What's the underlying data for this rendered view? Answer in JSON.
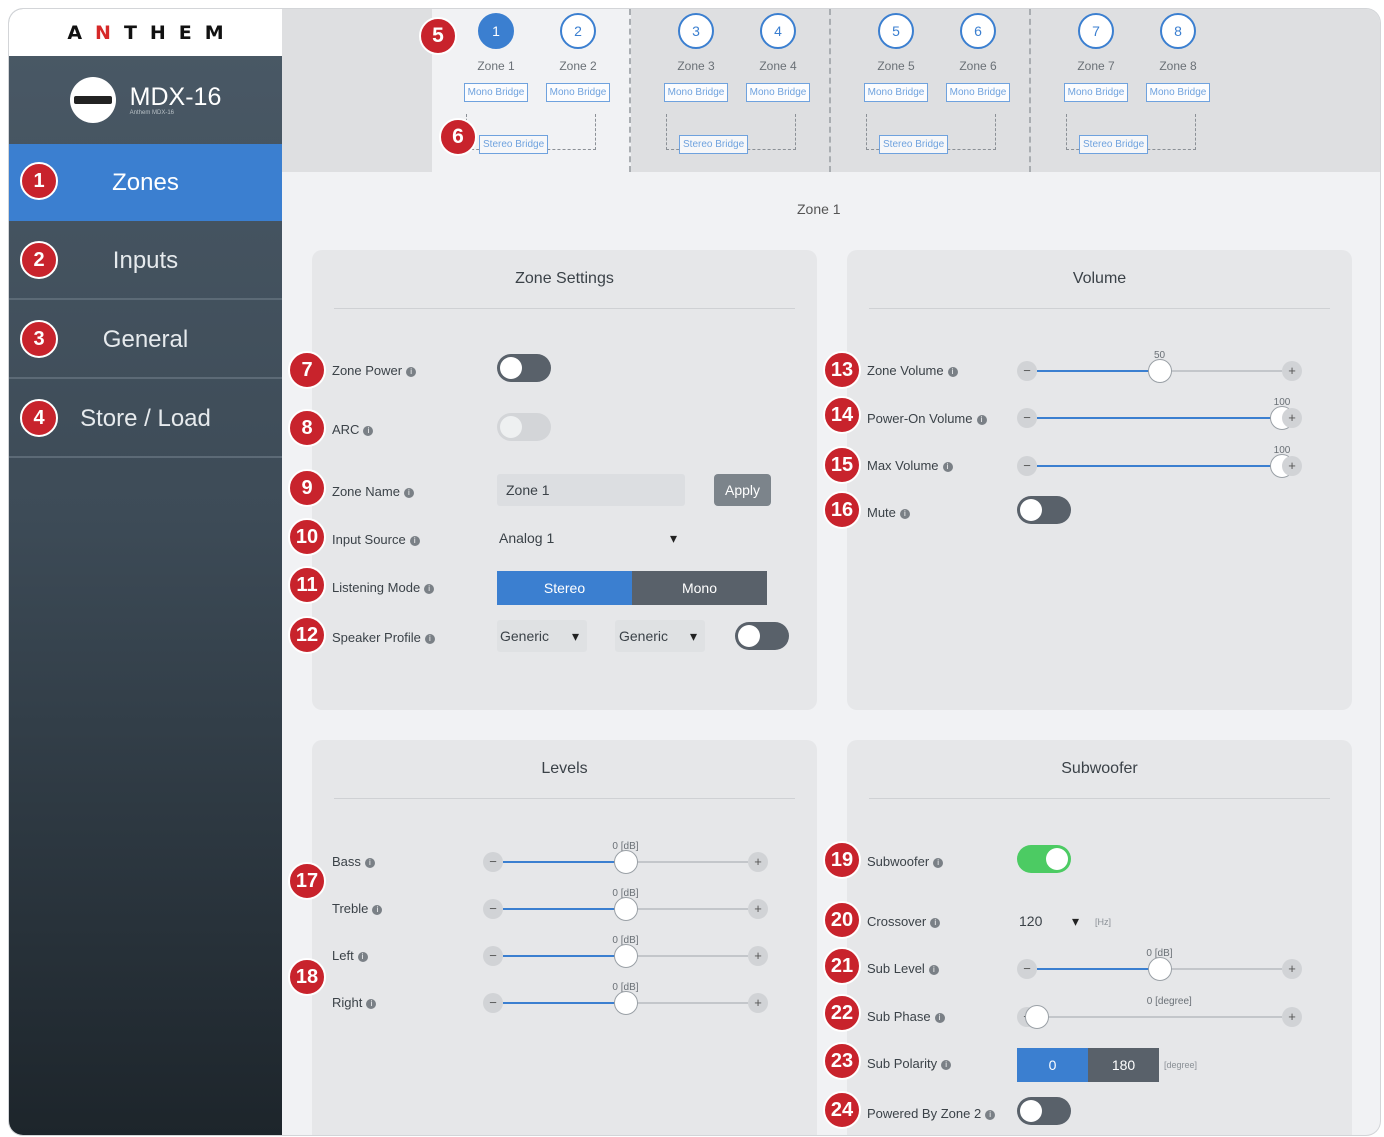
{
  "brand": {
    "logo_a": "A",
    "logo_n": "N",
    "logo_rest": "THEM",
    "device": "MDX-16",
    "device_sub": "Anthem MDX-16"
  },
  "nav": [
    {
      "label": "Zones",
      "badge": "1"
    },
    {
      "label": "Inputs",
      "badge": "2"
    },
    {
      "label": "General",
      "badge": "3"
    },
    {
      "label": "Store / Load",
      "badge": "4"
    }
  ],
  "zones": [
    {
      "num": "1",
      "label": "Zone 1",
      "bridge": "Mono Bridge"
    },
    {
      "num": "2",
      "label": "Zone 2",
      "bridge": "Mono Bridge"
    },
    {
      "num": "3",
      "label": "Zone 3",
      "bridge": "Mono Bridge"
    },
    {
      "num": "4",
      "label": "Zone 4",
      "bridge": "Mono Bridge"
    },
    {
      "num": "5",
      "label": "Zone 5",
      "bridge": "Mono Bridge"
    },
    {
      "num": "6",
      "label": "Zone 6",
      "bridge": "Mono Bridge"
    },
    {
      "num": "7",
      "label": "Zone 7",
      "bridge": "Mono Bridge"
    },
    {
      "num": "8",
      "label": "Zone 8",
      "bridge": "Mono Bridge"
    }
  ],
  "stereo_bridge": "Stereo Bridge",
  "zone_title": "Zone 1",
  "zone_settings": {
    "title": "Zone Settings",
    "zone_power": {
      "label": "Zone Power",
      "on": false
    },
    "arc": {
      "label": "ARC",
      "enabled": false
    },
    "zone_name": {
      "label": "Zone Name",
      "value": "Zone 1",
      "apply": "Apply"
    },
    "input_source": {
      "label": "Input Source",
      "value": "Analog 1"
    },
    "listening_mode": {
      "label": "Listening Mode",
      "options": [
        "Stereo",
        "Mono"
      ],
      "selected": "Stereo"
    },
    "speaker_profile": {
      "label": "Speaker Profile",
      "left": "Generic",
      "right": "Generic",
      "on": false
    }
  },
  "volume": {
    "title": "Volume",
    "zone_volume": {
      "label": "Zone Volume",
      "value": "50",
      "level": 0.5
    },
    "power_on_volume": {
      "label": "Power-On Volume",
      "value": "100",
      "level": 1.0
    },
    "max_volume": {
      "label": "Max Volume",
      "value": "100",
      "level": 1.0
    },
    "mute": {
      "label": "Mute",
      "on": false
    }
  },
  "levels": {
    "title": "Levels",
    "bass": {
      "label": "Bass",
      "value": "0 [dB]",
      "level": 0.5
    },
    "treble": {
      "label": "Treble",
      "value": "0 [dB]",
      "level": 0.5
    },
    "left": {
      "label": "Left",
      "value": "0 [dB]",
      "level": 0.5
    },
    "right": {
      "label": "Right",
      "value": "0 [dB]",
      "level": 0.5
    }
  },
  "subwoofer": {
    "title": "Subwoofer",
    "subwoofer": {
      "label": "Subwoofer",
      "on": true
    },
    "crossover": {
      "label": "Crossover",
      "value": "120",
      "unit": "[Hz]"
    },
    "sub_level": {
      "label": "Sub Level",
      "value": "0 [dB]",
      "level": 0.5
    },
    "sub_phase": {
      "label": "Sub Phase",
      "value": "0 [degree]",
      "level": 0.0
    },
    "sub_polarity": {
      "label": "Sub Polarity",
      "options": [
        "0",
        "180"
      ],
      "selected": "0",
      "unit": "[degree]"
    },
    "powered_by_zone2": {
      "label": "Powered By Zone 2",
      "on": false
    }
  },
  "callouts": [
    "5",
    "6",
    "7",
    "8",
    "9",
    "10",
    "11",
    "12",
    "13",
    "14",
    "15",
    "16",
    "17",
    "18",
    "19",
    "20",
    "21",
    "22",
    "23",
    "24"
  ],
  "colors": {
    "accent": "#3b7fd0",
    "callout": "#c8232c",
    "toggle_on": "#4ccb63",
    "sidebar": "#3d4b57"
  }
}
